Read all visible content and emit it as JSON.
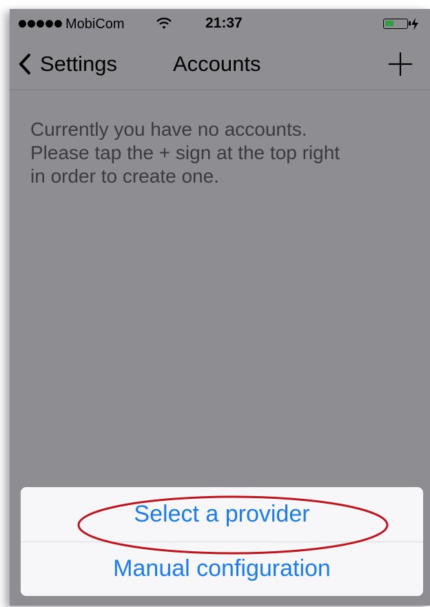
{
  "status_bar": {
    "carrier": "MobiCom",
    "time": "21:37",
    "signal_bars": 5,
    "battery_color": "#2ea043"
  },
  "nav_bar": {
    "back_label": "Settings",
    "title": "Accounts",
    "add_icon": "plus-icon",
    "back_icon": "chevron-left-icon"
  },
  "message": {
    "lines": [
      "Currently you have no accounts.",
      "Please tap the + sign at the top right",
      "in order to create one."
    ]
  },
  "action_sheet": {
    "options": [
      {
        "label": "Select a provider",
        "highlighted": true
      },
      {
        "label": "Manual configuration",
        "highlighted": false
      }
    ],
    "text_color": "#1a7cf0",
    "highlight_color": "#c0141c"
  }
}
